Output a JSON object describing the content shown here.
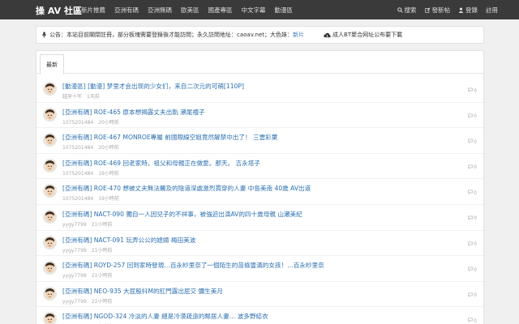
{
  "nav": {
    "brand": "操 AV 社區",
    "links": [
      "新片推薦",
      "亞洲有碼",
      "亞洲無碼",
      "歐美區",
      "國產專區",
      "中文字幕",
      "動漫區"
    ],
    "search": "搜索",
    "new_post": "發新帖",
    "login": "登錄",
    "register": "註冊"
  },
  "notice": {
    "label": "公告：",
    "text": "本站目前關閉註冊，部分板塊需要登錄後才能訪問；永久訪問地址：",
    "domain": "caoav.net",
    "sister_label": "；大色妹：",
    "sister_link": "新片",
    "bt_link": "成人BT聚合网址公布要下載"
  },
  "tabs": [
    "最新"
  ],
  "icons": {
    "mic": "microphone-icon",
    "cloud": "cloud-download-icon",
    "search": "search-icon",
    "edit": "edit-icon",
    "user": "user-icon",
    "comment": "comment-icon"
  },
  "colors": {
    "navbar": "#3a3a3a",
    "link": "#2a6fb0",
    "accent": "#3b7bbf"
  },
  "topics": [
    {
      "title": "[動漫區] [動漫] 梦里才会出现的少女们，来自二次元的可萌[110P]",
      "author": "越来十年",
      "time": "1天前",
      "replies": "0"
    },
    {
      "title": "[亞洲有碼] ROE-465 原本想揭露丈夫出軌 瀨尾禮子",
      "author": "1075201484",
      "time": "20小時前",
      "replies": "0"
    },
    {
      "title": "[亞洲有碼] ROE-467 MONROE專屬 前國際線空姐竟然解禁中出了！ 三雲彩葉",
      "author": "1075201484",
      "time": "20小時前",
      "replies": "0"
    },
    {
      "title": "[亞洲有碼] ROE-469 回老家時，祖父和母親正在做愛。那天。 吉永塔子",
      "author": "1075201484",
      "time": "19小時前",
      "replies": "0"
    },
    {
      "title": "[亞洲有碼] ROE-470 想被丈夫無法觸及的陰道深處激烈貫穿的人妻 中島美南 40歲 AV出道",
      "author": "1075201484",
      "time": "19小時前",
      "replies": "0"
    },
    {
      "title": "[亞洲有碼] NACT-090 獨自一人因兒子的不祥事，被強迫出演AV的四十歲母親 山瀬美紀",
      "author": "yygy7799",
      "time": "21小時前",
      "replies": "0"
    },
    {
      "title": "[亞洲有碼] NACT-091 玩弄公公的媳婦 梅田美波",
      "author": "yygy7799",
      "time": "21小時前",
      "replies": "0"
    },
    {
      "title": "[亞洲有碼] ROYD-257 回到家時發現…百永紗里奈了一個陌生的苗條豐滿的女孩！…百永紗里奈",
      "author": "yygy7799",
      "time": "21小時前",
      "replies": "0"
    },
    {
      "title": "[亞洲有碼] NEO-935 大屁股抖M的肛門露出屁交 彌生美月",
      "author": "yygy7799",
      "time": "21小時前",
      "replies": "0"
    },
    {
      "title": "[亞洲有碼] NGOD-324 冷淡的人妻 總是冷漠疏遠的鄰居人妻… 波多野結衣",
      "author": "yygy7799",
      "time": "21小時前",
      "replies": "0"
    }
  ]
}
